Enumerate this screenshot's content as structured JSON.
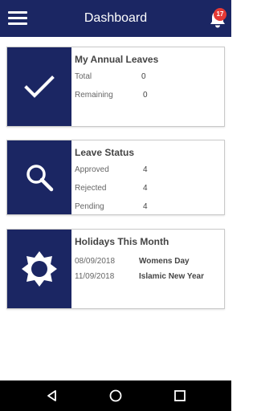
{
  "header": {
    "title": "Dashboard",
    "notification_count": "17"
  },
  "annual_leaves": {
    "title": "My Annual Leaves",
    "rows": [
      {
        "label": "Total",
        "value": "0"
      },
      {
        "label": "Remaining",
        "value": "0"
      }
    ]
  },
  "leave_status": {
    "title": "Leave Status",
    "rows": [
      {
        "label": "Approved",
        "value": "4"
      },
      {
        "label": "Rejected",
        "value": "4"
      },
      {
        "label": "Pending",
        "value": "4"
      }
    ]
  },
  "holidays": {
    "title": "Holidays This Month",
    "items": [
      {
        "date": "08/09/2018",
        "name": "Womens Day"
      },
      {
        "date": "11/09/2018",
        "name": "Islamic New Year"
      }
    ]
  },
  "colors": {
    "primary": "#1b2663",
    "badge": "#e53935",
    "navbar": "#000000"
  },
  "icons": {
    "menu": "menu-icon",
    "notifications": "bell-icon",
    "annual_leaves": "checkmark-icon",
    "leave_status": "search-icon",
    "holidays": "sun-icon",
    "back": "back-triangle-icon",
    "home": "home-circle-icon",
    "recents": "recents-square-icon"
  }
}
